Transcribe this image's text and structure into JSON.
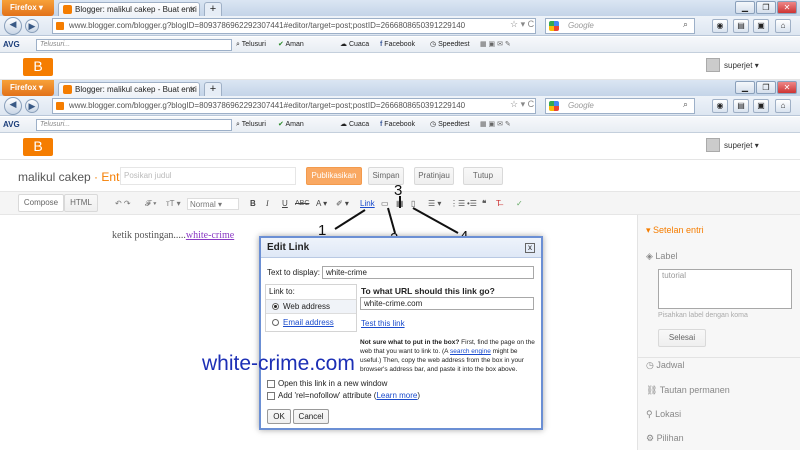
{
  "browser_top": {
    "firefox_label": "Firefox",
    "tab_title": "Blogger: malikul cakep - Buat entri",
    "new_tab": "+",
    "url": "www.blogger.com/blogger.g?blogID=8093786962292307441#editor/target=post;postID=2666808650391229140",
    "search_placeholder": "Google",
    "avg_logo": "AVG",
    "avg_search_placeholder": "Telusuri...",
    "avg_items": [
      "Telusuri",
      "Aman",
      "Cuaca",
      "Facebook",
      "Speedtest"
    ]
  },
  "browser_bottom": {
    "firefox_label": "Firefox",
    "tab_title": "Blogger: malikul cakep - Buat entri",
    "new_tab": "+",
    "url": "www.blogger.com/blogger.g?blogID=8093786962292307441#editor/target=post;postID=2666808650391229140",
    "search_placeholder": "Google",
    "avg_logo": "AVG",
    "avg_search_placeholder": "Telusuri...",
    "avg_items": [
      "Telusuri",
      "Aman",
      "Cuaca",
      "Facebook",
      "Speedtest"
    ]
  },
  "blogger": {
    "username": "superjet",
    "blog_name": "malikul cakep",
    "sep": "·",
    "section": "Entri",
    "title_placeholder": "Posikan judul",
    "buttons": {
      "publish": "Publikasikan",
      "save": "Simpan",
      "preview": "Pratinjau",
      "close": "Tutup"
    },
    "modes": {
      "compose": "Compose",
      "html": "HTML"
    },
    "toolbar": {
      "font_size": "Normal",
      "bold": "B",
      "italic": "I",
      "underline": "U",
      "strike": "ABC",
      "link": "Link",
      "text_color": "A"
    },
    "editor_text": "ketik postingan.....",
    "editor_link": "white-crime"
  },
  "annotations": [
    "1",
    "2",
    "3",
    "4"
  ],
  "watermark": "white-crime.com",
  "sidebar": {
    "heading": "Setelan entri",
    "label_section": "Label",
    "label_value": "tutorial",
    "label_hint": "Pisahkan label dengan koma",
    "done_button": "Selesai",
    "items": [
      "Jadwal",
      "Tautan permanen",
      "Lokasi",
      "Pilihan"
    ]
  },
  "dialog": {
    "title": "Edit Link",
    "close": "x",
    "text_to_display_label": "Text to display:",
    "text_to_display_value": "white-crime",
    "link_to_label": "Link to:",
    "opt_web": "Web address",
    "opt_email": "Email address",
    "url_heading": "To what URL should this link go?",
    "url_value": "white-crime.com",
    "test_link": "Test this link",
    "help_bold": "Not sure what to put in the box?",
    "help_text_1": " First, find the page on the web that you want to link to. (A ",
    "help_link": "search engine",
    "help_text_2": " might be useful.) Then, copy the web address from the box in your browser's address bar, and paste it into the box above.",
    "chk_new_window": "Open this link in a new window",
    "chk_nofollow": "Add 'rel=nofollow' attribute (",
    "learn_more": "Learn more",
    "chk_nofollow_end": ")",
    "ok": "OK",
    "cancel": "Cancel"
  },
  "colors": {
    "accent_orange": "#f57d00",
    "link_blue": "#1a4bcc",
    "watermark_blue": "#1c2fb5",
    "dialog_border": "#6b8fd4"
  }
}
